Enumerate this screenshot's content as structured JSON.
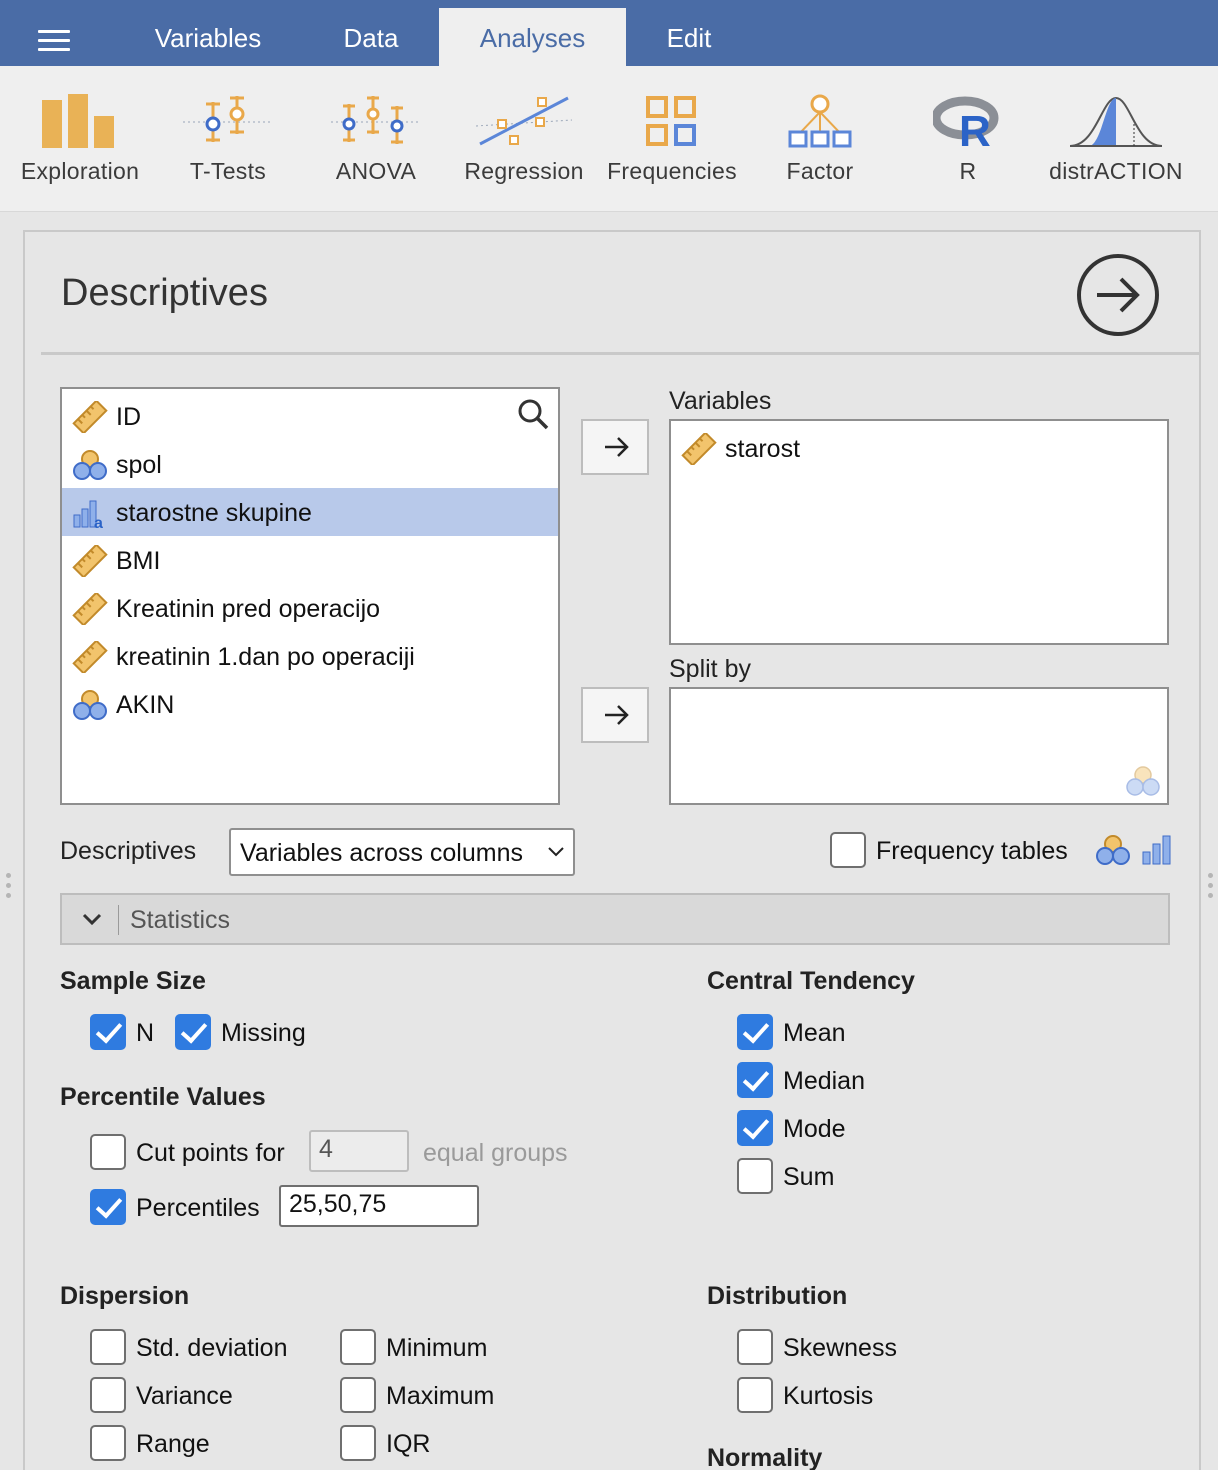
{
  "topbar": {
    "tabs": [
      {
        "label": "Variables",
        "active": false
      },
      {
        "label": "Data",
        "active": false
      },
      {
        "label": "Analyses",
        "active": true
      },
      {
        "label": "Edit",
        "active": false
      }
    ]
  },
  "ribbon": {
    "items": [
      {
        "label": "Exploration",
        "icon": "exploration-icon"
      },
      {
        "label": "T-Tests",
        "icon": "t-tests-icon"
      },
      {
        "label": "ANOVA",
        "icon": "anova-icon"
      },
      {
        "label": "Regression",
        "icon": "regression-icon"
      },
      {
        "label": "Frequencies",
        "icon": "frequencies-icon"
      },
      {
        "label": "Factor",
        "icon": "factor-icon"
      },
      {
        "label": "R",
        "icon": "r-icon"
      },
      {
        "label": "distrACTION",
        "icon": "distraction-icon"
      }
    ]
  },
  "panel": {
    "title": "Descriptives",
    "source_vars": [
      {
        "name": "ID",
        "type": "continuous-icon",
        "selected": false
      },
      {
        "name": "spol",
        "type": "nominal-icon",
        "selected": false
      },
      {
        "name": "starostne skupine",
        "type": "nominal-text-icon",
        "selected": true
      },
      {
        "name": "BMI",
        "type": "continuous-icon",
        "selected": false
      },
      {
        "name": "Kreatinin pred operacijo",
        "type": "continuous-icon",
        "selected": false
      },
      {
        "name": "kreatinin 1.dan po operaciji",
        "type": "continuous-icon",
        "selected": false
      },
      {
        "name": "AKIN",
        "type": "nominal-icon",
        "selected": false
      }
    ],
    "variables_label": "Variables",
    "variables": [
      {
        "name": "starost",
        "type": "continuous-icon"
      }
    ],
    "splitby_label": "Split by",
    "descriptives_label": "Descriptives",
    "descriptives_select": "Variables across columns",
    "frequency_tables_label": "Frequency tables",
    "frequency_tables_checked": false,
    "statistics_label": "Statistics",
    "sample_size": {
      "heading": "Sample Size",
      "n": {
        "label": "N",
        "checked": true
      },
      "missing": {
        "label": "Missing",
        "checked": true
      }
    },
    "percentile_values": {
      "heading": "Percentile Values",
      "cut_points": {
        "label": "Cut points for",
        "checked": false,
        "value": "4",
        "suffix": "equal groups"
      },
      "percentiles": {
        "label": "Percentiles",
        "checked": true,
        "value": "25,50,75"
      }
    },
    "central_tendency": {
      "heading": "Central Tendency",
      "mean": {
        "label": "Mean",
        "checked": true
      },
      "median": {
        "label": "Median",
        "checked": true
      },
      "mode": {
        "label": "Mode",
        "checked": true
      },
      "sum": {
        "label": "Sum",
        "checked": false
      }
    },
    "dispersion": {
      "heading": "Dispersion",
      "std": {
        "label": "Std. deviation",
        "checked": false
      },
      "variance": {
        "label": "Variance",
        "checked": false
      },
      "range": {
        "label": "Range",
        "checked": false
      },
      "minimum": {
        "label": "Minimum",
        "checked": false
      },
      "maximum": {
        "label": "Maximum",
        "checked": false
      },
      "iqr": {
        "label": "IQR",
        "checked": false
      }
    },
    "distribution": {
      "heading": "Distribution",
      "skewness": {
        "label": "Skewness",
        "checked": false
      },
      "kurtosis": {
        "label": "Kurtosis",
        "checked": false
      }
    },
    "normality_heading": "Normality"
  },
  "colors": {
    "topbar": "#4a6ca6",
    "checkbox_on": "#2f7be0",
    "selection": "#b8c9ea",
    "ruler": "#e9b256",
    "nominal_blue": "#3f6cc8"
  }
}
